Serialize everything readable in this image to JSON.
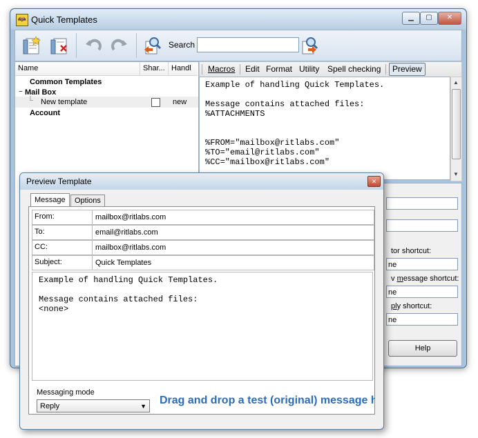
{
  "main_window": {
    "title": "Quick Templates",
    "search_label": "Search",
    "search_value": "",
    "columns": [
      "Name",
      "Shar...",
      "Handl"
    ],
    "tree": {
      "common": "Common Templates",
      "mailbox": "Mail Box",
      "new_template": "New template",
      "new_template_handler": "new",
      "account": "Account"
    },
    "menu": [
      "Macros",
      "Edit",
      "Format",
      "Utility",
      "Spell checking",
      "Preview"
    ],
    "editor_text": "Example of handling Quick Templates.\n\nMessage contains attached files:\n%ATTACHMENTS\n\n\n%FROM=\"mailbox@ritlabs.com\"\n%TO=\"email@ritlabs.com\"\n%CC=\"mailbox@ritlabs.com\"",
    "partial_labels": {
      "shortcut1": "tor shortcut:",
      "shortcut1_value": "ne",
      "shortcut2_prefix": "v ",
      "shortcut2_underlined": "m",
      "shortcut2_rest": "essage shortcut:",
      "shortcut2_value": "ne",
      "shortcut3_underlined": "pl",
      "shortcut3_rest": "y shortcut:",
      "shortcut3_value": "ne"
    },
    "help_label": "Help"
  },
  "preview_dialog": {
    "title": "Preview Template",
    "tabs": [
      "Message",
      "Options"
    ],
    "from_label": "From:",
    "from_value": "mailbox@ritlabs.com",
    "to_label": "To:",
    "to_value": "email@ritlabs.com",
    "cc_label": "CC:",
    "cc_value": "mailbox@ritlabs.com",
    "subject_label": "Subject:",
    "subject_value": "Quick Templates",
    "body": "Example of handling Quick Templates.\n\nMessage contains attached files:\n<none>",
    "mode_label": "Messaging mode",
    "mode_value": "Reply",
    "drag_hint": "Drag and drop a test (original) message h"
  },
  "colors": {
    "accent": "#2a6cc0",
    "titlebar": "#c4d6e8"
  }
}
